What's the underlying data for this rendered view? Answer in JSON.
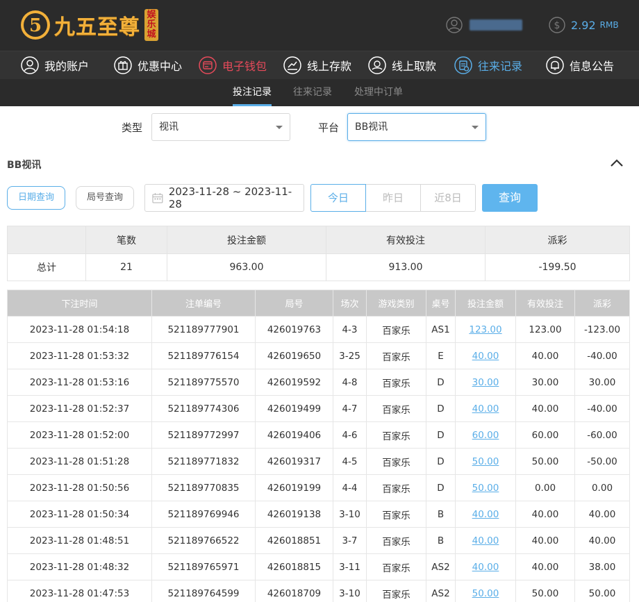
{
  "brand": {
    "name": "九五至尊",
    "badge": [
      "娱",
      "乐",
      "城"
    ]
  },
  "account": {
    "balance": "2.92",
    "unit": "RMB"
  },
  "nav": [
    {
      "label": "我的账户",
      "icon": "user-circle-icon",
      "state": "normal"
    },
    {
      "label": "优惠中心",
      "icon": "gift-icon",
      "state": "normal"
    },
    {
      "label": "电子钱包",
      "icon": "wallet-icon",
      "state": "red"
    },
    {
      "label": "线上存款",
      "icon": "deposit-icon",
      "state": "normal"
    },
    {
      "label": "线上取款",
      "icon": "withdraw-icon",
      "state": "normal"
    },
    {
      "label": "往来记录",
      "icon": "records-icon",
      "state": "active"
    },
    {
      "label": "信息公告",
      "icon": "bell-icon",
      "state": "normal"
    }
  ],
  "subnav": [
    {
      "label": "投注记录",
      "active": true
    },
    {
      "label": "往来记录",
      "active": false
    },
    {
      "label": "处理中订单",
      "active": false
    }
  ],
  "filters": {
    "type_label": "类型",
    "type_value": "视讯",
    "platform_label": "平台",
    "platform_value": "BB视讯"
  },
  "section": {
    "title": "BB视讯"
  },
  "query": {
    "date_tab": "日期查询",
    "round_tab": "局号查询",
    "date_range": "2023-11-28 ~ 2023-11-28",
    "quick": [
      "今日",
      "昨日",
      "近8日"
    ],
    "submit": "查询"
  },
  "summary": {
    "headers": [
      "",
      "笔数",
      "投注金额",
      "有效投注",
      "派彩"
    ],
    "row": [
      "总计",
      "21",
      "963.00",
      "913.00",
      "-199.50"
    ]
  },
  "records": {
    "headers": [
      "下注时间",
      "注单编号",
      "局号",
      "场次",
      "游戏类别",
      "桌号",
      "投注金额",
      "有效投注",
      "派彩"
    ],
    "rows": [
      [
        "2023-11-28 01:54:18",
        "521189777901",
        "426019763",
        "4-3",
        "百家乐",
        "AS1",
        "123.00",
        "123.00",
        "-123.00"
      ],
      [
        "2023-11-28 01:53:32",
        "521189776154",
        "426019650",
        "3-25",
        "百家乐",
        "E",
        "40.00",
        "40.00",
        "-40.00"
      ],
      [
        "2023-11-28 01:53:16",
        "521189775570",
        "426019592",
        "4-8",
        "百家乐",
        "D",
        "30.00",
        "30.00",
        "30.00"
      ],
      [
        "2023-11-28 01:52:37",
        "521189774306",
        "426019499",
        "4-7",
        "百家乐",
        "D",
        "40.00",
        "40.00",
        "-40.00"
      ],
      [
        "2023-11-28 01:52:00",
        "521189772997",
        "426019406",
        "4-6",
        "百家乐",
        "D",
        "60.00",
        "60.00",
        "-60.00"
      ],
      [
        "2023-11-28 01:51:28",
        "521189771832",
        "426019317",
        "4-5",
        "百家乐",
        "D",
        "50.00",
        "50.00",
        "-50.00"
      ],
      [
        "2023-11-28 01:50:56",
        "521189770835",
        "426019199",
        "4-4",
        "百家乐",
        "D",
        "50.00",
        "0.00",
        "0.00"
      ],
      [
        "2023-11-28 01:50:34",
        "521189769946",
        "426019138",
        "3-10",
        "百家乐",
        "B",
        "40.00",
        "40.00",
        "40.00"
      ],
      [
        "2023-11-28 01:48:51",
        "521189766522",
        "426018851",
        "3-7",
        "百家乐",
        "B",
        "40.00",
        "40.00",
        "40.00"
      ],
      [
        "2023-11-28 01:48:32",
        "521189765971",
        "426018815",
        "3-11",
        "百家乐",
        "AS2",
        "40.00",
        "40.00",
        "38.00"
      ],
      [
        "2023-11-28 01:47:53",
        "521189764599",
        "426018709",
        "3-10",
        "百家乐",
        "AS2",
        "50.00",
        "50.00",
        "50.00"
      ]
    ]
  },
  "colors": {
    "accent": "#5aaee8",
    "negative": "#e74a5a",
    "header_bg": "#2b2b2b",
    "nav_bg": "#333333"
  }
}
